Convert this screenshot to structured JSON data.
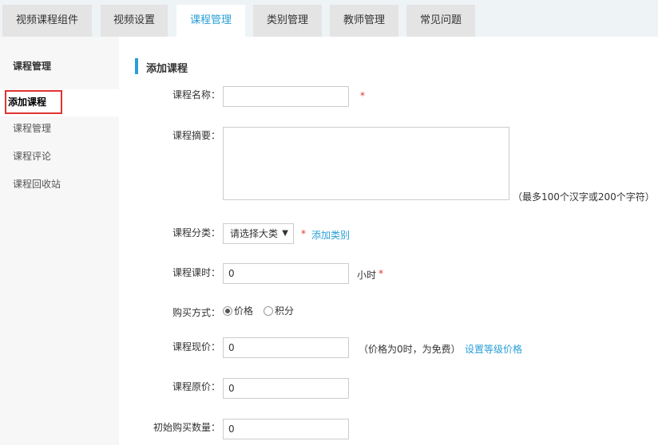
{
  "tabs": [
    {
      "label": "视频课程组件"
    },
    {
      "label": "视频设置"
    },
    {
      "label": "课程管理"
    },
    {
      "label": "类别管理"
    },
    {
      "label": "教师管理"
    },
    {
      "label": "常见问题"
    }
  ],
  "sidebar": {
    "title": "课程管理",
    "items": [
      {
        "label": "添加课程"
      },
      {
        "label": "课程管理"
      },
      {
        "label": "课程评论"
      },
      {
        "label": "课程回收站"
      }
    ]
  },
  "form": {
    "section_title": "添加课程",
    "required_mark": "*",
    "name": {
      "label": "课程名称：",
      "value": ""
    },
    "summary": {
      "label": "课程摘要：",
      "value": "",
      "hint": "（最多100个汉字或200个字符）"
    },
    "category": {
      "label": "课程分类：",
      "selected": "请选择大类",
      "add_link": "添加类别"
    },
    "hours": {
      "label": "课程课时：",
      "value": "0",
      "unit": "小时"
    },
    "buy_method": {
      "label": "购买方式：",
      "option_price": "价格",
      "option_points": "积分",
      "selected": "价格"
    },
    "current_price": {
      "label": "课程现价：",
      "value": "0",
      "hint": "（价格为0时，为免费）",
      "link": "设置等级价格"
    },
    "original_price": {
      "label": "课程原价：",
      "value": "0"
    },
    "initial_buyers": {
      "label": "初始购买数量：",
      "value": "0"
    }
  },
  "colors": {
    "accent": "#2a9fd6",
    "required": "#e03333",
    "highlight_box": "#e03333"
  }
}
